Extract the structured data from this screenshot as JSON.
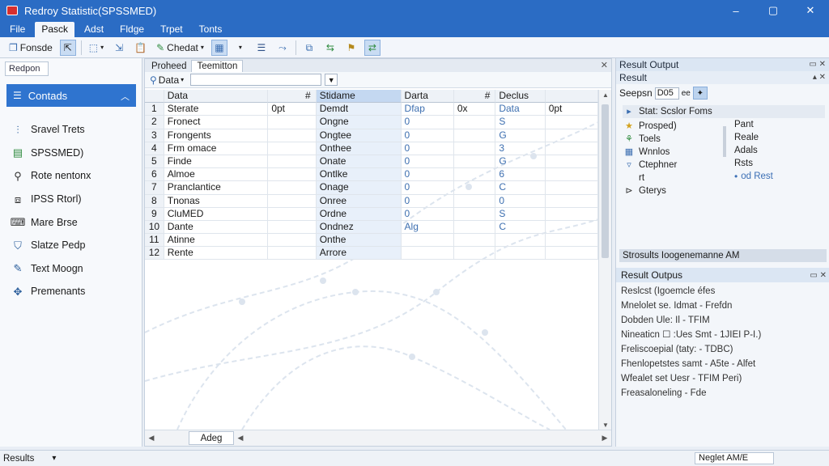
{
  "window": {
    "title": "Redroy Statistic(SPSSMED)",
    "minimize": "–",
    "maximize": "▢",
    "close": "✕"
  },
  "menu": [
    "File",
    "Pasck",
    "Adst",
    "Fldge",
    "Trpet",
    "Tonts"
  ],
  "toolbar": {
    "button_console": "Fonsde",
    "button_chart": "Chedat"
  },
  "sidebar": {
    "tab": "Redpon",
    "section": "Contads",
    "items": [
      {
        "label": "Sravel Trets",
        "icon": "chart-icon"
      },
      {
        "label": "SPSSMED)",
        "icon": "table-icon"
      },
      {
        "label": "Rote nentonx",
        "icon": "person-icon"
      },
      {
        "label": "IPSS Rtorl)",
        "icon": "code-icon"
      },
      {
        "label": "Mare Brse",
        "icon": "keyboard-icon"
      },
      {
        "label": "Slatze Pedp",
        "icon": "shield-icon"
      },
      {
        "label": "Text Moogn",
        "icon": "pen-icon"
      },
      {
        "label": "Premenants",
        "icon": "move-icon"
      }
    ]
  },
  "center": {
    "tabs": [
      "Proheed",
      "Teemitton"
    ],
    "filter_label": "Data",
    "grid_headers": [
      "",
      "Data",
      "#",
      "Stidame",
      "Darta",
      "#",
      "Declus",
      ""
    ],
    "rows": [
      [
        "1",
        "Sterate",
        "0pt",
        "Demdt",
        "Dfap",
        "0x",
        "Data",
        "0pt"
      ],
      [
        "2",
        "Fronect",
        "",
        "Ongne",
        "0",
        "",
        "S",
        ""
      ],
      [
        "3",
        "Frongents",
        "",
        "Ongtee",
        "0",
        "",
        "G",
        ""
      ],
      [
        "4",
        "Frm omace",
        "",
        "Onthee",
        "0",
        "",
        "3",
        ""
      ],
      [
        "5",
        "Finde",
        "",
        "Onate",
        "0",
        "",
        "G",
        ""
      ],
      [
        "6",
        "Almoe",
        "",
        "Ontlke",
        "0",
        "",
        "6",
        ""
      ],
      [
        "7",
        "Pranclantice",
        "",
        "Onage",
        "0",
        "",
        "C",
        ""
      ],
      [
        "8",
        "Tnonas",
        "",
        "Onree",
        "0",
        "",
        "0",
        ""
      ],
      [
        "9",
        "CluMED",
        "",
        "Ordne",
        "0",
        "",
        "S",
        ""
      ],
      [
        "10",
        "Dante",
        "",
        "Ondnez",
        "Alg",
        "",
        "C",
        ""
      ],
      [
        "11",
        "Atinne",
        "",
        "Onthe",
        "",
        "",
        "",
        ""
      ],
      [
        "12",
        "Rente",
        "",
        "Arrore",
        "",
        "",
        "",
        ""
      ]
    ],
    "sheet_tab": "Adeg"
  },
  "results": {
    "title": "Result Output",
    "subtitle": "Result",
    "search_label": "Seepsn",
    "search_value": "D05",
    "search_suffix": "ee",
    "tree_header": "Stat: Scslor Foms",
    "tree": [
      {
        "label": "Prosped)",
        "icon": "star-icon"
      },
      {
        "label": "Toels",
        "icon": "tool-icon"
      },
      {
        "label": "Wnnlos",
        "icon": "grid-icon"
      },
      {
        "label": "Ctephner",
        "icon": "funnel-icon"
      },
      {
        "label": "rt",
        "icon": "blank-icon"
      },
      {
        "label": "Gterys",
        "icon": "arrow-icon"
      }
    ],
    "tree_right": [
      "Pant",
      "Reale",
      "Adals",
      "Rsts",
      "od Rest"
    ],
    "footer": "Strosults Ioogenemanne AM",
    "output_title": "Result Outpus",
    "output_lines": [
      "Reslcst (Igoemcle éfes",
      "Mnelolet se. Idmat - Frefdn",
      "Dobden Ule: Il - TFIM",
      "Nineaticn          ☐ :Ues Smt - 1JIEI P-I.)",
      "Freliscoepial (taty: - TDBC)",
      "Fhenlopetstes samt - A5te - Alfet",
      "Wfealet set Uesr - TFIM Peri)",
      "Freasaloneling - Fde"
    ]
  },
  "status": {
    "left": "Results",
    "right": "Neglet AM/E"
  },
  "colors": {
    "accent": "#2b6cc4",
    "selection": "#2f74cf",
    "link": "#3b6fb5"
  }
}
